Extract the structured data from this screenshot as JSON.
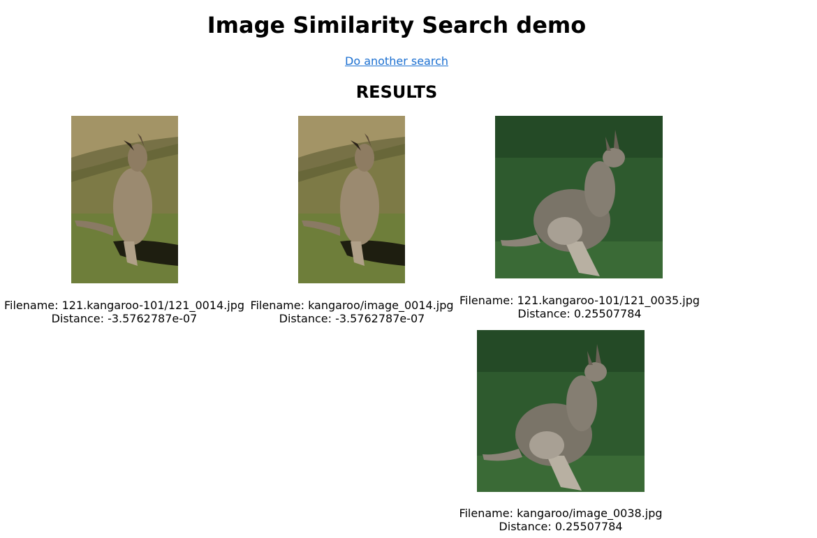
{
  "page": {
    "title": "Image Similarity Search demo",
    "link_text": "Do another search",
    "results_heading": "RESULTS"
  },
  "results": [
    {
      "filename_label": "Filename: 121.kangaroo-101/121_0014.jpg",
      "distance_label": "Distance: -3.5762787e-07",
      "image": "kangaroo-dry-grass-photo"
    },
    {
      "filename_label": "Filename: kangaroo/image_0014.jpg",
      "distance_label": "Distance: -3.5762787e-07",
      "image": "kangaroo-dry-grass-photo"
    },
    {
      "filename_label": "Filename: 121.kangaroo-101/121_0035.jpg",
      "distance_label": "Distance: 0.25507784",
      "image": "kangaroo-green-grass-photo"
    },
    {
      "filename_label": "Filename: kangaroo/image_0038.jpg",
      "distance_label": "Distance: 0.25507784",
      "image": "kangaroo-green-grass-photo"
    }
  ],
  "colors": {
    "link": "#1a6fd1",
    "dry_grass": "#8a8a4a",
    "green_grass": "#2e5a2e"
  }
}
